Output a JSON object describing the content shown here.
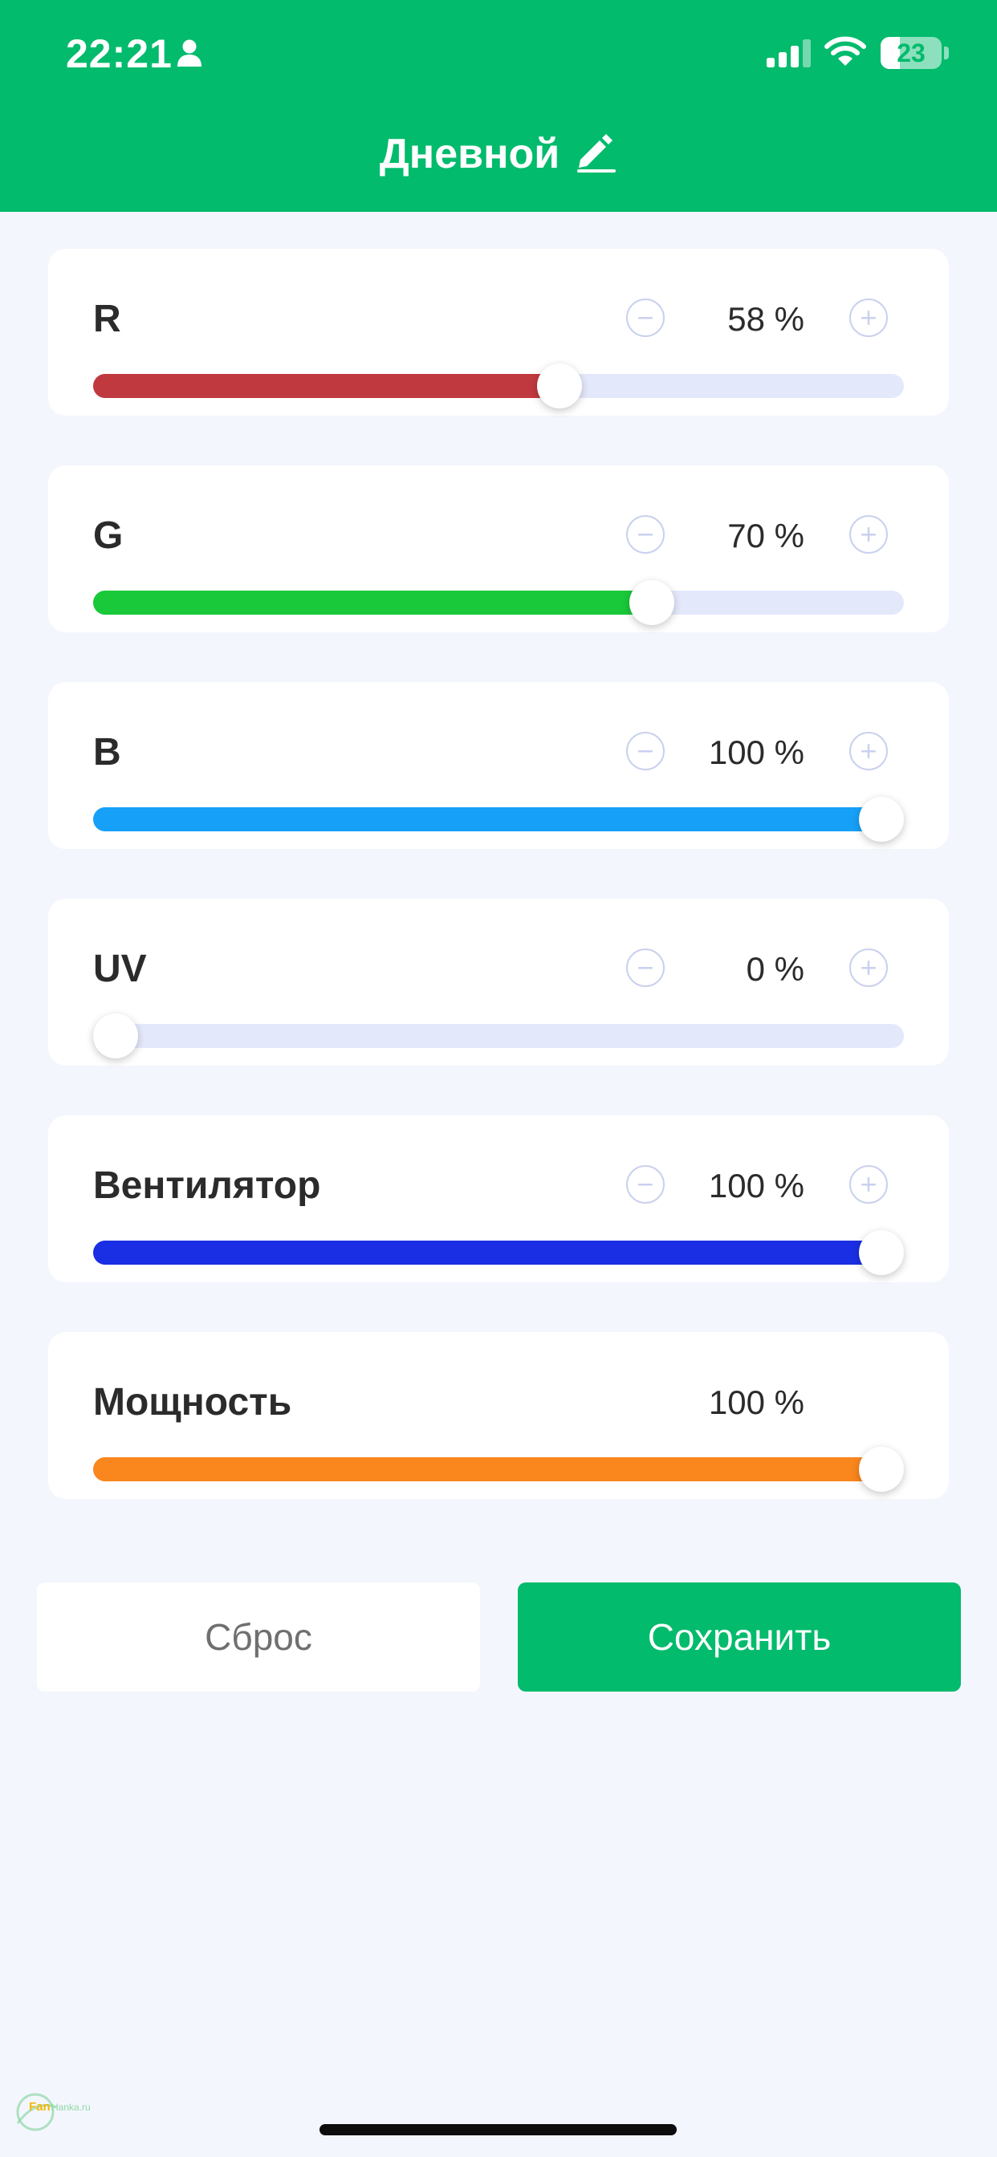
{
  "status_bar": {
    "time": "22:21",
    "battery": "23",
    "icons": [
      "person-icon",
      "signal-icon",
      "wifi-icon",
      "battery-icon"
    ]
  },
  "header": {
    "title": "Дневной",
    "edit_icon": "pencil-icon"
  },
  "channels": [
    {
      "label": "R",
      "value_text": "58 %",
      "value": 58,
      "color": "#c0393f",
      "has_stepper": true
    },
    {
      "label": "G",
      "value_text": "70 %",
      "value": 70,
      "color": "#19c93a",
      "has_stepper": true
    },
    {
      "label": "B",
      "value_text": "100 %",
      "value": 100,
      "color": "#17a0f8",
      "has_stepper": true
    },
    {
      "label": "UV",
      "value_text": "0 %",
      "value": 0,
      "color": "#e4e8fb",
      "has_stepper": true
    },
    {
      "label": "Вентилятор",
      "value_text": "100 %",
      "value": 100,
      "color": "#1a2fe3",
      "has_stepper": true
    },
    {
      "label": "Мощность",
      "value_text": "100 %",
      "value": 100,
      "color": "#fa861e",
      "has_stepper": false
    }
  ],
  "actions": {
    "reset_label": "Сброс",
    "save_label": "Сохранить"
  },
  "watermark": {
    "text_prefix": "Fan",
    "text_suffix": "Hanka.ru"
  },
  "colors": {
    "accent": "#02bb6d",
    "background": "#f4f6fd",
    "track": "#e4e8fb",
    "stepper_border": "#c9d1ee"
  }
}
